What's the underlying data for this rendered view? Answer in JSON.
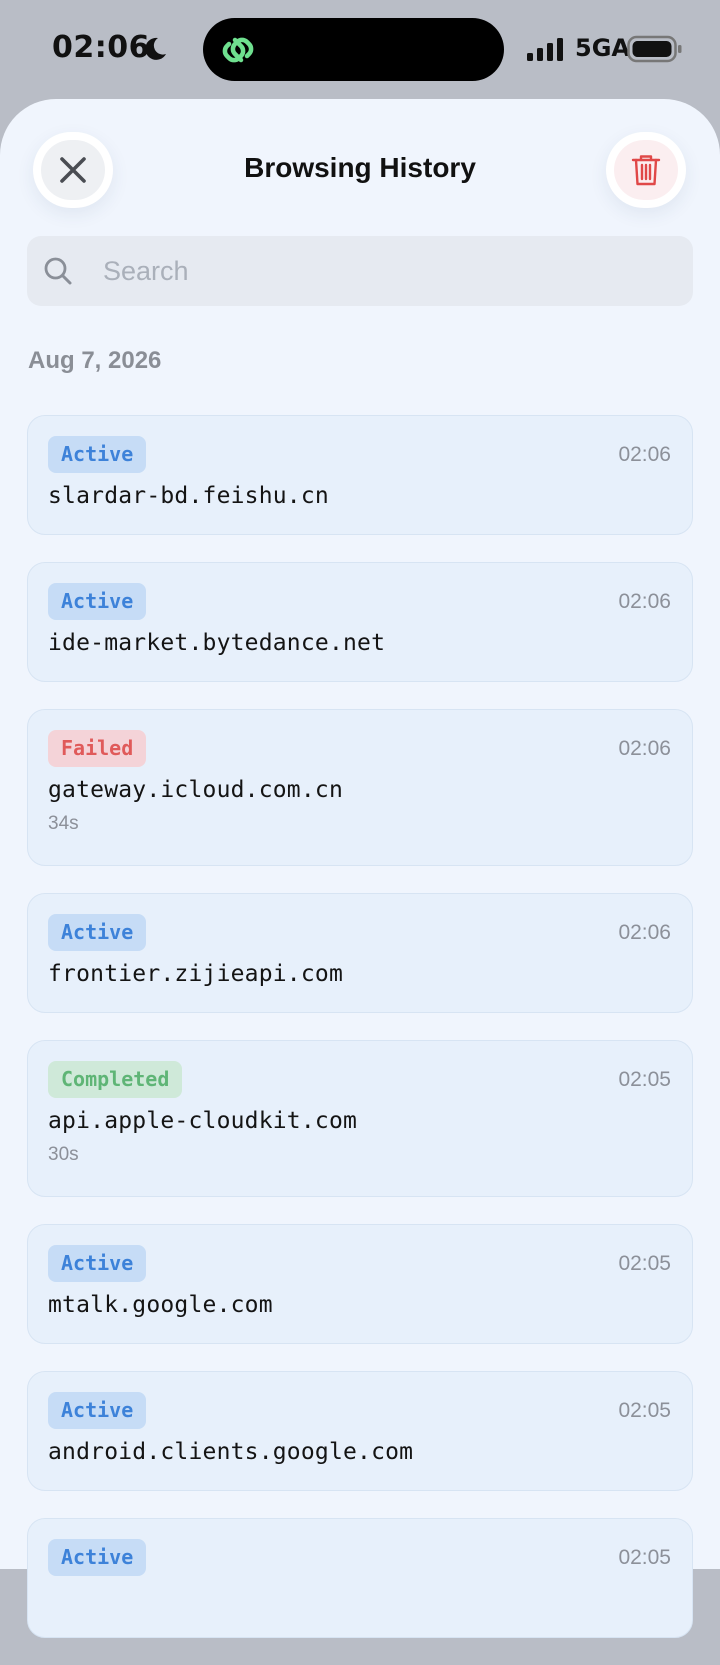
{
  "status_bar": {
    "time": "02:06",
    "network": "5GA"
  },
  "header": {
    "title": "Browsing History"
  },
  "search": {
    "placeholder": "Search"
  },
  "date_section": {
    "label": "Aug 7, 2026"
  },
  "history": [
    {
      "status": "Active",
      "status_kind": "active",
      "time": "02:06",
      "host": "slardar-bd.feishu.cn",
      "duration": ""
    },
    {
      "status": "Active",
      "status_kind": "active",
      "time": "02:06",
      "host": "ide-market.bytedance.net",
      "duration": ""
    },
    {
      "status": "Failed",
      "status_kind": "failed",
      "time": "02:06",
      "host": "gateway.icloud.com.cn",
      "duration": "34s"
    },
    {
      "status": "Active",
      "status_kind": "active",
      "time": "02:06",
      "host": "frontier.zijieapi.com",
      "duration": ""
    },
    {
      "status": "Completed",
      "status_kind": "completed",
      "time": "02:05",
      "host": "api.apple-cloudkit.com",
      "duration": "30s"
    },
    {
      "status": "Active",
      "status_kind": "active",
      "time": "02:05",
      "host": "mtalk.google.com",
      "duration": ""
    },
    {
      "status": "Active",
      "status_kind": "active",
      "time": "02:05",
      "host": "android.clients.google.com",
      "duration": ""
    },
    {
      "status": "Active",
      "status_kind": "active",
      "time": "02:05",
      "host": "",
      "duration": ""
    }
  ],
  "colors": {
    "active": "#3d82d9",
    "failed": "#e05a5a",
    "completed": "#5fb576",
    "sheet_background": "#f0f5fd"
  },
  "icons": {
    "close": "close-icon",
    "delete": "trash-icon",
    "search": "search-icon",
    "island": "link-icon"
  }
}
